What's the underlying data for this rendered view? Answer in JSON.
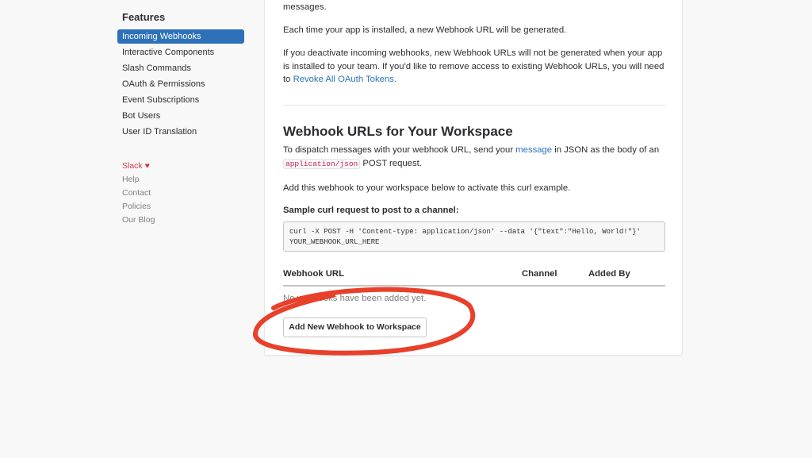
{
  "sidebar": {
    "heading": "Features",
    "items": [
      {
        "label": "Incoming Webhooks",
        "active": true
      },
      {
        "label": "Interactive Components"
      },
      {
        "label": "Slash Commands"
      },
      {
        "label": "OAuth & Permissions"
      },
      {
        "label": "Event Subscriptions"
      },
      {
        "label": "Bot Users"
      },
      {
        "label": "User ID Translation"
      }
    ],
    "footer": {
      "slack": "Slack",
      "heart": "♥",
      "help": "Help",
      "contact": "Contact",
      "policies": "Policies",
      "blog": "Our Blog"
    }
  },
  "main": {
    "p0": "messages.",
    "p1": "Each time your app is installed, a new Webhook URL will be generated.",
    "p2": "If you deactivate incoming webhooks, new Webhook URLs will not be generated when your app is installed to your team. If you'd like to remove access to existing Webhook URLs, you will need to ",
    "p2_link": "Revoke All OAuth Tokens.",
    "section_title": "Webhook URLs for Your Workspace",
    "p3a": "To dispatch messages with your webhook URL, send your ",
    "p3_link": "message",
    "p3b": " in JSON as the body of an ",
    "p3_code": "application/json",
    "p3c": " POST request.",
    "p4": "Add this webhook to your workspace below to activate this curl example.",
    "sample_label": "Sample curl request to post to a channel:",
    "curl_line1": "curl -X POST -H 'Content-type: application/json' --data '{\"text\":\"Hello, World!\"}'",
    "curl_line2": "YOUR_WEBHOOK_URL_HERE",
    "table": {
      "columns": [
        "Webhook URL",
        "Channel",
        "Added By"
      ],
      "empty": "No webhooks have been added yet."
    },
    "add_button": "Add New Webhook to Workspace"
  },
  "colors": {
    "accent": "#2d72b8",
    "annotation": "#e8402a",
    "slack": "#d33b4c"
  }
}
